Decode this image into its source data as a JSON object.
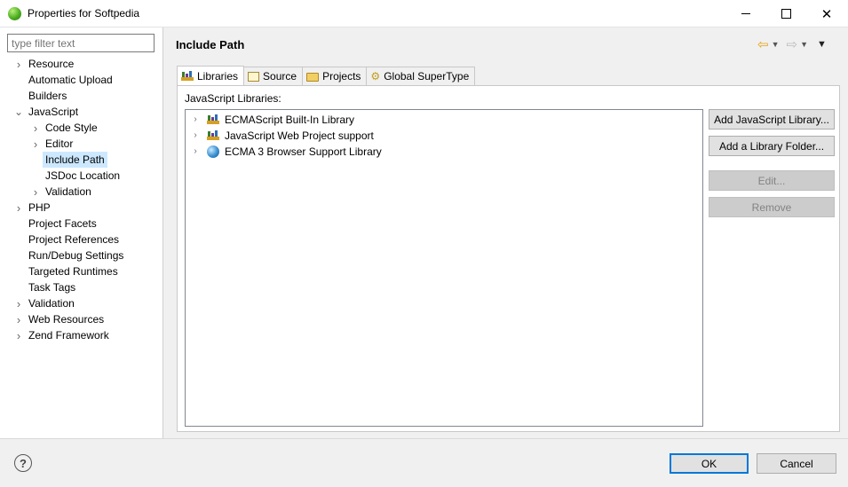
{
  "window": {
    "title": "Properties for Softpedia"
  },
  "filter": {
    "placeholder": "type filter text"
  },
  "nav_tree": [
    {
      "label": "Resource",
      "expandable": true
    },
    {
      "label": "Automatic Upload",
      "expandable": false
    },
    {
      "label": "Builders",
      "expandable": false
    },
    {
      "label": "JavaScript",
      "expandable": true,
      "expanded": true
    },
    {
      "label": "Code Style",
      "expandable": true
    },
    {
      "label": "Editor",
      "expandable": true
    },
    {
      "label": "Include Path",
      "expandable": false,
      "selected": true
    },
    {
      "label": "JSDoc Location",
      "expandable": false
    },
    {
      "label": "Validation",
      "expandable": true
    },
    {
      "label": "PHP",
      "expandable": true
    },
    {
      "label": "Project Facets",
      "expandable": false
    },
    {
      "label": "Project References",
      "expandable": false
    },
    {
      "label": "Run/Debug Settings",
      "expandable": false
    },
    {
      "label": "Targeted Runtimes",
      "expandable": false
    },
    {
      "label": "Task Tags",
      "expandable": false
    },
    {
      "label": "Validation",
      "expandable": true
    },
    {
      "label": "Web Resources",
      "expandable": true
    },
    {
      "label": "Zend Framework",
      "expandable": true
    }
  ],
  "page": {
    "title": "Include Path"
  },
  "tabs": [
    {
      "label": "Libraries",
      "active": true,
      "icon": "libraries-icon"
    },
    {
      "label": "Source",
      "active": false,
      "icon": "source-icon"
    },
    {
      "label": "Projects",
      "active": false,
      "icon": "projects-icon"
    },
    {
      "label": "Global SuperType",
      "active": false,
      "icon": "supertype-icon"
    }
  ],
  "libraries": {
    "label": "JavaScript Libraries:",
    "items": [
      {
        "label": "ECMAScript Built-In Library",
        "icon": "library-icon"
      },
      {
        "label": "JavaScript Web Project support",
        "icon": "library-icon"
      },
      {
        "label": "ECMA 3 Browser Support Library",
        "icon": "globe-icon"
      }
    ]
  },
  "buttons": {
    "add_library": "Add JavaScript Library...",
    "add_folder": "Add a Library Folder...",
    "edit": "Edit...",
    "remove": "Remove"
  },
  "dialog": {
    "ok": "OK",
    "cancel": "Cancel",
    "help": "?"
  }
}
